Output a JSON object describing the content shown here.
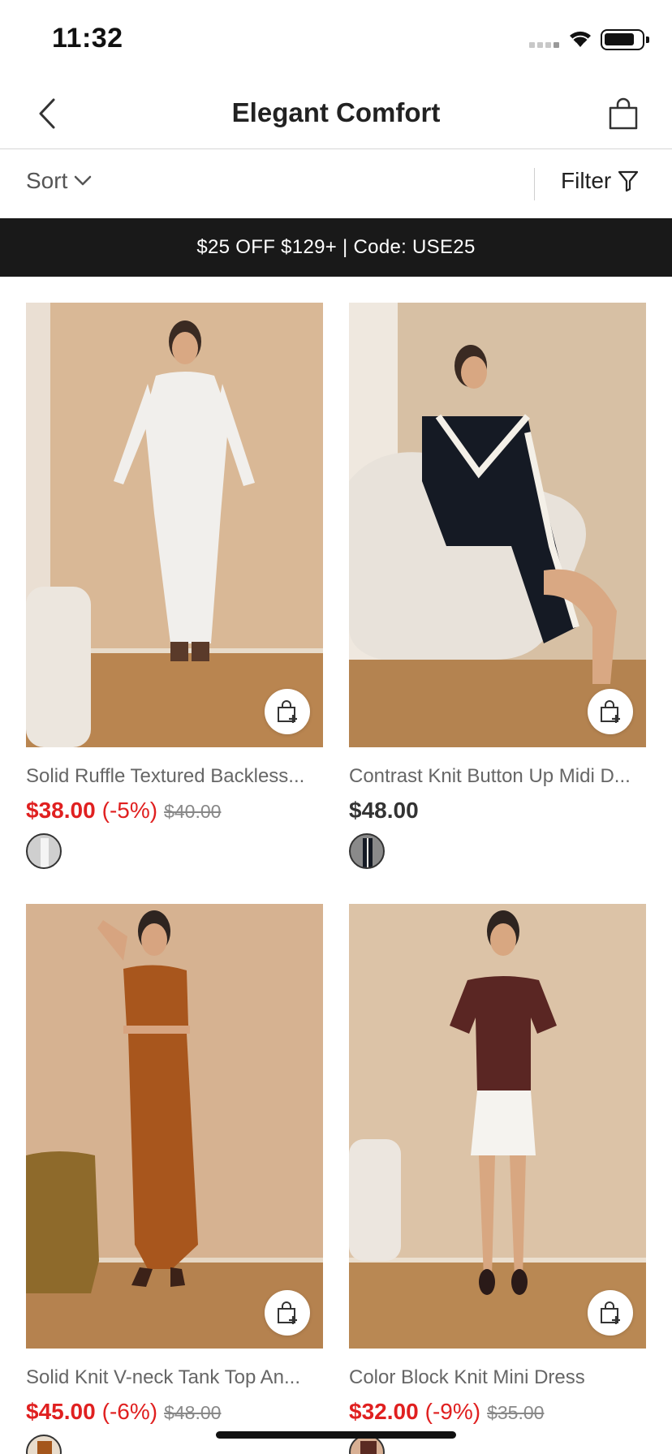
{
  "status_bar": {
    "time": "11:32"
  },
  "nav": {
    "title": "Elegant Comfort",
    "back_icon": "chevron-left-icon",
    "bag_icon": "shopping-bag-icon"
  },
  "toolbar": {
    "sort_label": "Sort",
    "filter_label": "Filter"
  },
  "promo": {
    "text": "$25 OFF $129+ | Code: USE25"
  },
  "products": [
    {
      "name": "Solid Ruffle Textured Backless...",
      "sale_price": "$38.00",
      "discount": "(-5%)",
      "original_price": "$40.00",
      "swatch_color": "#cfcfcf"
    },
    {
      "name": "Contrast Knit Button Up Midi D...",
      "price": "$48.00",
      "swatch_color": "#222222"
    },
    {
      "name": "Solid Knit V-neck Tank Top An...",
      "sale_price": "$45.00",
      "discount": "(-6%)",
      "original_price": "$48.00",
      "swatch_color": "#a4561c"
    },
    {
      "name": "Color Block Knit Mini Dress",
      "sale_price": "$32.00",
      "discount": "(-9%)",
      "original_price": "$35.00",
      "swatch_color": "#5a2a22"
    }
  ],
  "colors": {
    "sale_red": "#e02020",
    "banner_bg": "#191919"
  }
}
